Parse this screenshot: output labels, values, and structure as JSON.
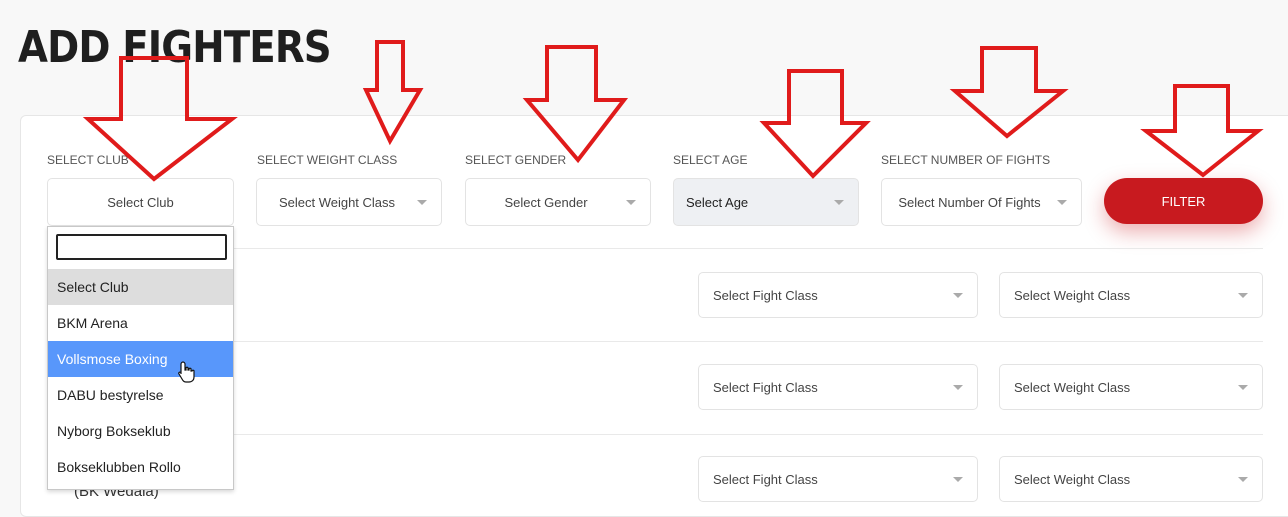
{
  "page": {
    "title": "ADD FIGHTERS"
  },
  "filters": {
    "club": {
      "label": "SELECT CLUB",
      "value": "Select Club"
    },
    "weight": {
      "label": "SELECT WEIGHT CLASS",
      "value": "Select Weight Class"
    },
    "gender": {
      "label": "SELECT GENDER",
      "value": "Select Gender"
    },
    "age": {
      "label": "SELECT AGE",
      "value": "Select Age"
    },
    "fights": {
      "label": "SELECT NUMBER OF FIGHTS",
      "value": "Select Number Of Fights"
    },
    "filter_button": "FILTER"
  },
  "club_dropdown": {
    "search_value": "",
    "options": [
      "Select Club",
      "BKM Arena",
      "Vollsmose Boxing",
      "DABU bestyrelse",
      "Nyborg Bokseklub",
      "Bokseklubben Rollo"
    ],
    "selected_index": 0,
    "hover_index": 2
  },
  "rows": [
    {
      "fight_class": "Select Fight Class",
      "weight_class": "Select Weight Class"
    },
    {
      "fight_class": "Select Fight Class",
      "weight_class": "Select Weight Class"
    },
    {
      "fight_class": "Select Fight Class",
      "weight_class": "Select Weight Class",
      "partial_text": "(BK Wedala)"
    }
  ],
  "annotation": {
    "arrow_color": "#e01b1b"
  },
  "colors": {
    "filter_button": "#c81a1f",
    "hover_option": "#5897fb"
  }
}
